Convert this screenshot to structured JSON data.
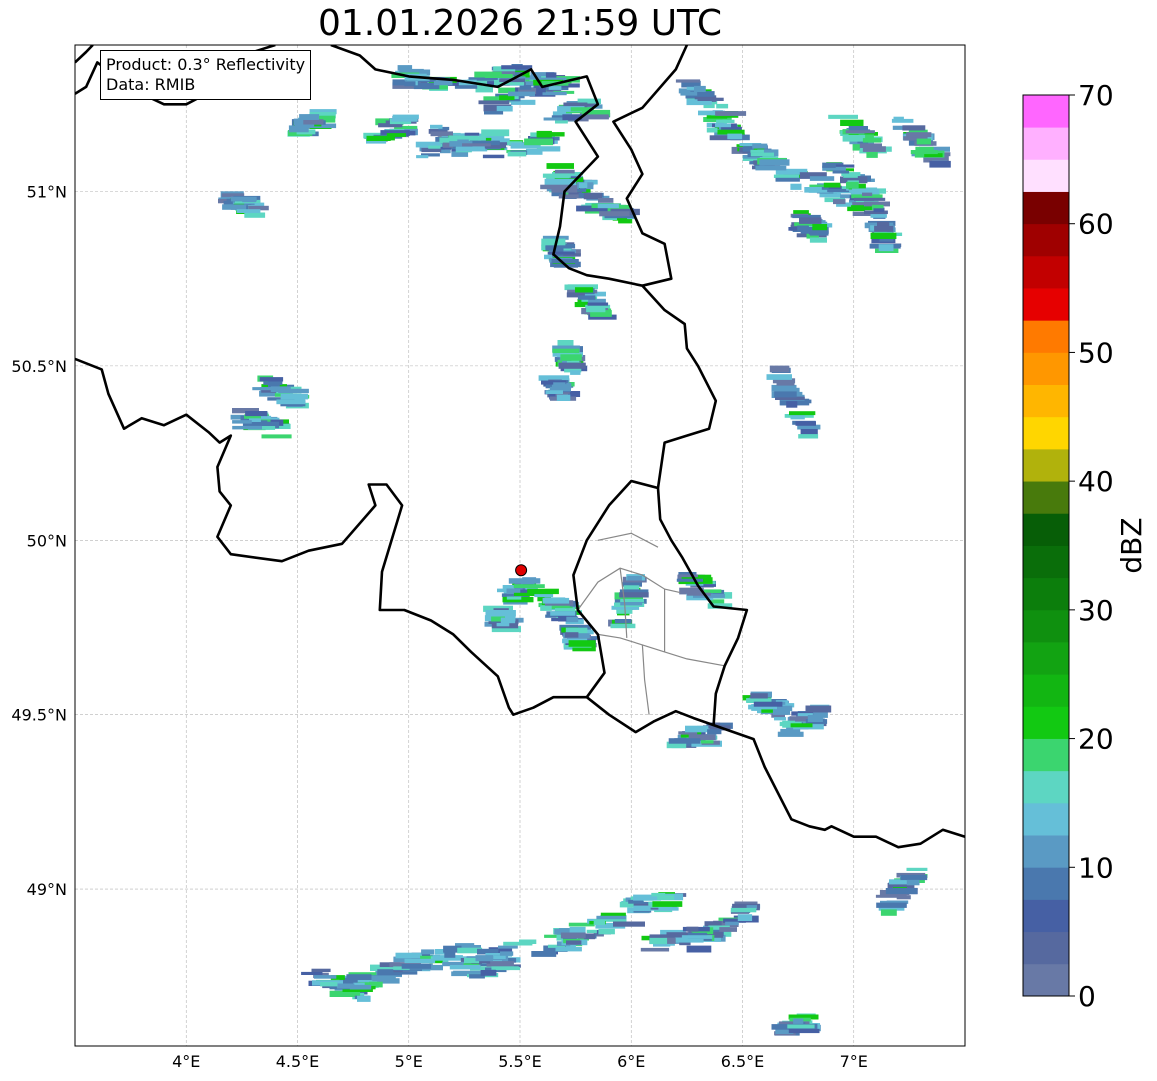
{
  "title": "01.01.2026 21:59 UTC",
  "info_box": {
    "product": "Product: 0.3° Reflectivity",
    "data": "Data: RMIB"
  },
  "map": {
    "lon_range": [
      3.5,
      7.5
    ],
    "lat_range": [
      48.55,
      51.42
    ],
    "lon_ticks": [
      {
        "value": 4.0,
        "label": "4°E"
      },
      {
        "value": 4.5,
        "label": "4.5°E"
      },
      {
        "value": 5.0,
        "label": "5°E"
      },
      {
        "value": 5.5,
        "label": "5.5°E"
      },
      {
        "value": 6.0,
        "label": "6°E"
      },
      {
        "value": 6.5,
        "label": "6.5°E"
      },
      {
        "value": 7.0,
        "label": "7°E"
      }
    ],
    "lat_ticks": [
      {
        "value": 49.0,
        "label": "49°N"
      },
      {
        "value": 49.5,
        "label": "49.5°N"
      },
      {
        "value": 50.0,
        "label": "50°N"
      },
      {
        "value": 50.5,
        "label": "50.5°N"
      },
      {
        "value": 51.0,
        "label": "51°N"
      }
    ],
    "grid": true,
    "radar_site": {
      "lon": 5.505,
      "lat": 49.914,
      "color": "#e00000"
    },
    "borders": [
      [
        [
          3.5,
          50.52
        ],
        [
          3.62,
          50.49
        ],
        [
          3.65,
          50.42
        ],
        [
          3.72,
          50.32
        ],
        [
          3.8,
          50.35
        ],
        [
          3.9,
          50.33
        ],
        [
          4.0,
          50.36
        ],
        [
          4.1,
          50.31
        ],
        [
          4.15,
          50.28
        ],
        [
          4.2,
          50.3
        ],
        [
          4.14,
          50.21
        ],
        [
          4.15,
          50.14
        ],
        [
          4.2,
          50.1
        ],
        [
          4.14,
          50.01
        ],
        [
          4.2,
          49.96
        ],
        [
          4.43,
          49.94
        ],
        [
          4.55,
          49.97
        ],
        [
          4.7,
          49.99
        ],
        [
          4.85,
          50.1
        ],
        [
          4.82,
          50.16
        ],
        [
          4.9,
          50.16
        ],
        [
          4.97,
          50.1
        ],
        [
          4.88,
          49.91
        ],
        [
          4.87,
          49.8
        ],
        [
          4.98,
          49.8
        ],
        [
          5.1,
          49.77
        ],
        [
          5.2,
          49.73
        ],
        [
          5.28,
          49.68
        ],
        [
          5.4,
          49.61
        ],
        [
          5.45,
          49.52
        ],
        [
          5.47,
          49.5
        ],
        [
          5.56,
          49.52
        ],
        [
          5.65,
          49.55
        ],
        [
          5.8,
          49.55
        ],
        [
          5.9,
          49.5
        ],
        [
          6.02,
          49.45
        ],
        [
          6.1,
          49.48
        ],
        [
          6.2,
          49.51
        ],
        [
          6.28,
          49.49
        ],
        [
          6.37,
          49.47
        ],
        [
          6.55,
          49.43
        ],
        [
          6.6,
          49.35
        ],
        [
          6.72,
          49.2
        ],
        [
          6.8,
          49.18
        ],
        [
          6.87,
          49.17
        ],
        [
          6.9,
          49.18
        ],
        [
          7.0,
          49.15
        ],
        [
          7.1,
          49.15
        ],
        [
          7.2,
          49.12
        ],
        [
          7.3,
          49.13
        ],
        [
          7.4,
          49.17
        ],
        [
          7.5,
          49.15
        ]
      ],
      [
        [
          5.8,
          49.55
        ],
        [
          5.88,
          49.62
        ],
        [
          5.85,
          49.73
        ],
        [
          5.76,
          49.8
        ],
        [
          5.74,
          49.9
        ],
        [
          5.8,
          50.0
        ],
        [
          5.9,
          50.1
        ],
        [
          6.0,
          50.17
        ],
        [
          6.12,
          50.15
        ],
        [
          6.13,
          50.06
        ],
        [
          6.18,
          50.0
        ],
        [
          6.23,
          49.95
        ],
        [
          6.3,
          49.87
        ],
        [
          6.37,
          49.81
        ],
        [
          6.52,
          49.8
        ],
        [
          6.48,
          49.72
        ],
        [
          6.42,
          49.64
        ],
        [
          6.38,
          49.56
        ],
        [
          6.37,
          49.47
        ]
      ],
      [
        [
          6.12,
          50.15
        ],
        [
          6.15,
          50.28
        ],
        [
          6.25,
          50.3
        ],
        [
          6.35,
          50.32
        ],
        [
          6.38,
          50.4
        ],
        [
          6.3,
          50.5
        ],
        [
          6.25,
          50.55
        ],
        [
          6.24,
          50.62
        ],
        [
          6.15,
          50.66
        ],
        [
          6.05,
          50.73
        ],
        [
          5.9,
          50.75
        ],
        [
          5.8,
          50.76
        ],
        [
          5.72,
          50.78
        ],
        [
          5.65,
          50.82
        ],
        [
          5.68,
          50.9
        ],
        [
          5.7,
          51.0
        ],
        [
          5.85,
          51.1
        ],
        [
          5.75,
          51.2
        ],
        [
          5.85,
          51.25
        ],
        [
          5.8,
          51.33
        ],
        [
          5.6,
          51.3
        ],
        [
          5.55,
          51.35
        ],
        [
          5.4,
          51.3
        ],
        [
          5.2,
          51.32
        ],
        [
          5.0,
          51.33
        ],
        [
          4.85,
          51.35
        ],
        [
          4.78,
          51.39
        ],
        [
          4.65,
          51.42
        ]
      ],
      [
        [
          6.05,
          50.73
        ],
        [
          6.18,
          50.75
        ],
        [
          6.15,
          50.85
        ],
        [
          6.05,
          50.88
        ],
        [
          5.98,
          50.98
        ],
        [
          6.05,
          51.05
        ],
        [
          6.0,
          51.12
        ],
        [
          5.92,
          51.2
        ],
        [
          6.05,
          51.24
        ],
        [
          6.2,
          51.35
        ],
        [
          6.25,
          51.42
        ]
      ],
      [
        [
          3.5,
          51.28
        ],
        [
          3.55,
          51.3
        ],
        [
          3.6,
          51.37
        ],
        [
          3.7,
          51.32
        ],
        [
          3.8,
          51.28
        ],
        [
          3.9,
          51.25
        ],
        [
          4.0,
          51.25
        ],
        [
          4.15,
          51.3
        ],
        [
          4.25,
          51.35
        ],
        [
          4.3,
          51.4
        ],
        [
          4.4,
          51.42
        ]
      ],
      [
        [
          3.5,
          51.37
        ],
        [
          3.55,
          51.4
        ],
        [
          3.58,
          51.42
        ]
      ]
    ],
    "regions": [
      [
        [
          5.76,
          49.8
        ],
        [
          5.85,
          49.88
        ],
        [
          5.95,
          49.92
        ],
        [
          6.05,
          49.9
        ],
        [
          6.15,
          49.86
        ],
        [
          6.22,
          49.85
        ]
      ],
      [
        [
          5.85,
          49.73
        ],
        [
          5.95,
          49.72
        ],
        [
          6.05,
          49.7
        ],
        [
          6.15,
          49.68
        ],
        [
          6.25,
          49.66
        ],
        [
          6.42,
          49.64
        ]
      ],
      [
        [
          5.95,
          49.92
        ],
        [
          5.97,
          49.82
        ],
        [
          5.98,
          49.72
        ]
      ],
      [
        [
          6.15,
          49.86
        ],
        [
          6.15,
          49.76
        ],
        [
          6.15,
          49.68
        ]
      ],
      [
        [
          6.05,
          49.7
        ],
        [
          6.06,
          49.6
        ],
        [
          6.08,
          49.5
        ]
      ],
      [
        [
          5.85,
          50.0
        ],
        [
          6.0,
          50.02
        ],
        [
          6.12,
          49.98
        ]
      ]
    ],
    "echo_bands": [
      [
        [
          5.5,
          51.33,
          5.72,
          51.3
        ],
        [
          5.38,
          51.25,
          5.68,
          51.3
        ],
        [
          5.25,
          51.3,
          5.5,
          51.34
        ],
        [
          4.98,
          51.33,
          5.18,
          51.3
        ],
        [
          5.12,
          51.17,
          5.25,
          51.12
        ]
      ],
      [
        [
          5.35,
          51.12,
          5.7,
          51.15
        ],
        [
          5.05,
          51.12,
          5.4,
          51.15
        ],
        [
          4.85,
          51.16,
          5.0,
          51.2
        ],
        [
          4.5,
          51.18,
          4.62,
          51.21
        ],
        [
          5.65,
          51.21,
          5.85,
          51.24
        ]
      ],
      [
        [
          5.68,
          51.05,
          5.8,
          51.0
        ],
        [
          5.65,
          51.03,
          5.75,
          51.0
        ],
        [
          5.8,
          50.98,
          5.98,
          50.92
        ],
        [
          5.65,
          50.85,
          5.72,
          50.8
        ],
        [
          5.75,
          50.72,
          5.88,
          50.65
        ]
      ],
      [
        [
          5.7,
          50.55,
          5.75,
          50.5
        ],
        [
          5.65,
          50.45,
          5.7,
          50.42
        ],
        [
          4.35,
          50.46,
          4.5,
          50.4
        ],
        [
          4.25,
          50.35,
          4.42,
          50.32
        ],
        [
          4.2,
          50.98,
          4.32,
          50.95
        ]
      ],
      [
        [
          6.25,
          51.3,
          6.45,
          51.2
        ],
        [
          6.35,
          51.2,
          6.6,
          51.1
        ],
        [
          6.55,
          51.12,
          6.75,
          51.02
        ],
        [
          6.8,
          51.03,
          7.08,
          50.95
        ],
        [
          6.9,
          51.08,
          7.12,
          50.98
        ]
      ],
      [
        [
          6.95,
          51.2,
          7.1,
          51.12
        ],
        [
          7.2,
          51.2,
          7.4,
          51.08
        ],
        [
          6.75,
          50.92,
          6.85,
          50.88
        ],
        [
          7.1,
          50.95,
          7.15,
          50.85
        ],
        [
          6.65,
          50.5,
          6.8,
          50.3
        ]
      ],
      [
        [
          5.95,
          49.75,
          6.02,
          49.88
        ],
        [
          5.45,
          49.83,
          5.55,
          49.88
        ],
        [
          5.6,
          49.83,
          5.75,
          49.78
        ],
        [
          5.72,
          49.74,
          5.8,
          49.7
        ],
        [
          6.25,
          49.88,
          6.4,
          49.83
        ]
      ],
      [
        [
          6.2,
          49.42,
          6.4,
          49.45
        ],
        [
          6.55,
          49.55,
          6.7,
          49.5
        ],
        [
          6.7,
          49.46,
          6.85,
          49.5
        ],
        [
          7.15,
          48.95,
          7.3,
          49.05
        ],
        [
          5.4,
          49.78,
          5.45,
          49.76
        ]
      ],
      [
        [
          4.75,
          48.72,
          5.0,
          48.78
        ],
        [
          4.95,
          48.78,
          5.3,
          48.82
        ],
        [
          5.25,
          48.8,
          5.75,
          48.85
        ],
        [
          5.7,
          48.86,
          6.0,
          48.92
        ],
        [
          6.0,
          48.95,
          6.2,
          48.97
        ]
      ],
      [
        [
          4.55,
          48.76,
          4.8,
          48.7
        ],
        [
          5.2,
          48.76,
          5.5,
          48.8
        ],
        [
          6.3,
          48.85,
          6.55,
          48.95
        ],
        [
          6.1,
          48.85,
          6.35,
          48.88
        ],
        [
          6.68,
          48.6,
          6.8,
          48.62
        ]
      ]
    ]
  },
  "colorbar": {
    "label": "dBZ",
    "min": 0,
    "max": 70,
    "step": 2.5,
    "ticks": [
      {
        "value": 0,
        "label": "0"
      },
      {
        "value": 10,
        "label": "10"
      },
      {
        "value": 20,
        "label": "20"
      },
      {
        "value": 30,
        "label": "30"
      },
      {
        "value": 40,
        "label": "40"
      },
      {
        "value": 50,
        "label": "50"
      },
      {
        "value": 60,
        "label": "60"
      },
      {
        "value": 70,
        "label": "70"
      }
    ],
    "colors": [
      "#6879a6",
      "#56699f",
      "#4660a4",
      "#4a78ae",
      "#5a9ac4",
      "#65bfd8",
      "#5dd6c2",
      "#3bd56f",
      "#12c912",
      "#12b612",
      "#12a312",
      "#0f900f",
      "#0c7e0c",
      "#0a6e0a",
      "#075e07",
      "#487a0c",
      "#b1b20c",
      "#ffd600",
      "#ffb600",
      "#ff9700",
      "#ff7a00",
      "#e60000",
      "#c20000",
      "#9f0000",
      "#790000",
      "#ffe0ff",
      "#ffb0ff",
      "#ff66ff",
      "#ea3cf2"
    ]
  }
}
